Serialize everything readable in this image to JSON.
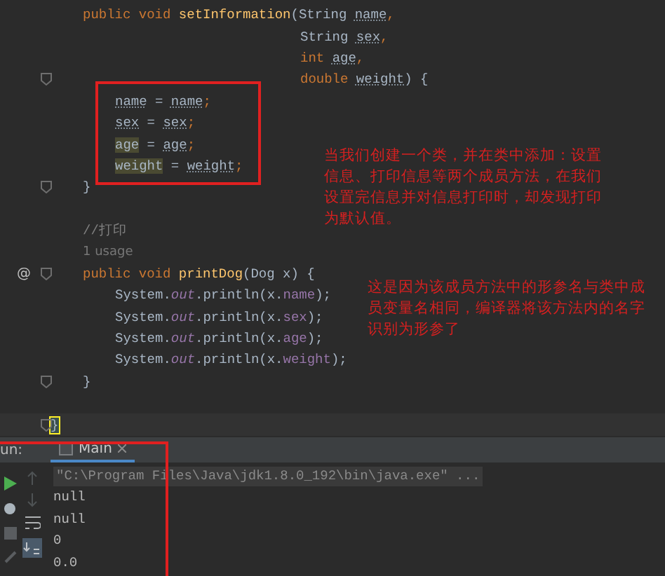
{
  "code_lines": [
    {
      "kind": "member",
      "fold": false,
      "tokens": [
        {
          "text": "public void ",
          "kind": "kw"
        },
        {
          "text": "setInformation",
          "kind": "fn"
        },
        {
          "text": "(String ",
          "kind": "txt"
        },
        {
          "text": "name",
          "kind": "ul"
        },
        {
          "text": ",",
          "kind": "kw"
        }
      ]
    },
    {
      "kind": "param",
      "fold": false,
      "tokens": [
        {
          "text": "String ",
          "kind": "txt"
        },
        {
          "text": "sex",
          "kind": "ul"
        },
        {
          "text": ",",
          "kind": "kw"
        }
      ]
    },
    {
      "kind": "param",
      "fold": false,
      "tokens": [
        {
          "text": "int ",
          "kind": "kw"
        },
        {
          "text": "age",
          "kind": "ul"
        },
        {
          "text": ",",
          "kind": "kw"
        }
      ]
    },
    {
      "kind": "param",
      "fold": true,
      "tokens": [
        {
          "text": "double ",
          "kind": "kw"
        },
        {
          "text": "weight",
          "kind": "ul"
        },
        {
          "text": ") {",
          "kind": "txt"
        }
      ]
    },
    {
      "kind": "body",
      "fold": false,
      "tokens": [
        {
          "text": "name",
          "kind": "ul"
        },
        {
          "text": " = ",
          "kind": "txt"
        },
        {
          "text": "name",
          "kind": "ul"
        },
        {
          "text": ";",
          "kind": "kw"
        }
      ]
    },
    {
      "kind": "body",
      "fold": false,
      "tokens": [
        {
          "text": "sex",
          "kind": "ul"
        },
        {
          "text": " = ",
          "kind": "txt"
        },
        {
          "text": "sex",
          "kind": "ul"
        },
        {
          "text": ";",
          "kind": "kw"
        }
      ]
    },
    {
      "kind": "body",
      "fold": false,
      "tokens": [
        {
          "text": "age",
          "kind": "hl"
        },
        {
          "text": " = ",
          "kind": "txt"
        },
        {
          "text": "age",
          "kind": "ul"
        },
        {
          "text": ";",
          "kind": "kw"
        }
      ]
    },
    {
      "kind": "body",
      "fold": false,
      "tokens": [
        {
          "text": "weight",
          "kind": "hl"
        },
        {
          "text": " = ",
          "kind": "txt"
        },
        {
          "text": "weight",
          "kind": "ul"
        },
        {
          "text": ";",
          "kind": "kw"
        }
      ]
    },
    {
      "kind": "member",
      "fold": true,
      "tokens": [
        {
          "text": "}",
          "kind": "txt"
        }
      ]
    },
    {
      "kind": "blank"
    },
    {
      "kind": "member",
      "fold": false,
      "tokens": [
        {
          "text": "//打印",
          "kind": "comment"
        }
      ]
    },
    {
      "kind": "member",
      "fold": false,
      "tokens": [
        {
          "text": "1 usage",
          "kind": "hint"
        }
      ]
    },
    {
      "kind": "member",
      "fold": true,
      "gutter": "@",
      "tokens": [
        {
          "text": "public void ",
          "kind": "kw"
        },
        {
          "text": "printDog",
          "kind": "fn"
        },
        {
          "text": "(Dog x) {",
          "kind": "txt"
        }
      ]
    },
    {
      "kind": "body",
      "fold": false,
      "tokens": [
        {
          "text": "System.",
          "kind": "txt"
        },
        {
          "text": "out",
          "kind": "static"
        },
        {
          "text": ".println(x.",
          "kind": "txt"
        },
        {
          "text": "name",
          "kind": "field"
        },
        {
          "text": ");",
          "kind": "txt"
        }
      ]
    },
    {
      "kind": "body",
      "fold": false,
      "tokens": [
        {
          "text": "System.",
          "kind": "txt"
        },
        {
          "text": "out",
          "kind": "static"
        },
        {
          "text": ".println(x.",
          "kind": "txt"
        },
        {
          "text": "sex",
          "kind": "field"
        },
        {
          "text": ");",
          "kind": "txt"
        }
      ]
    },
    {
      "kind": "body",
      "fold": false,
      "tokens": [
        {
          "text": "System.",
          "kind": "txt"
        },
        {
          "text": "out",
          "kind": "static"
        },
        {
          "text": ".println(x.",
          "kind": "txt"
        },
        {
          "text": "age",
          "kind": "field"
        },
        {
          "text": ");",
          "kind": "txt"
        }
      ]
    },
    {
      "kind": "body",
      "fold": false,
      "tokens": [
        {
          "text": "System.",
          "kind": "txt"
        },
        {
          "text": "out",
          "kind": "static"
        },
        {
          "text": ".println(x.",
          "kind": "txt"
        },
        {
          "text": "weight",
          "kind": "field"
        },
        {
          "text": ");",
          "kind": "txt"
        }
      ]
    },
    {
      "kind": "member",
      "fold": true,
      "tokens": [
        {
          "text": "}",
          "kind": "txt"
        }
      ]
    },
    {
      "kind": "blank"
    },
    {
      "kind": "top",
      "fold": true,
      "current": true,
      "tokens": [
        {
          "text": "}",
          "kind": "brace"
        }
      ]
    }
  ],
  "annotations": [
    {
      "text": "当我们创建一个类，并在类中添加：设置信息、打印信息等两个成员方法，在我们设置完信息并对信息打印时，却发现打印为默认值。"
    },
    {
      "text": "这是因为该成员方法中的形参名与类中成员变量名相同，编译器将该方法内的名字识别为形参了"
    }
  ],
  "run_panel": {
    "label": "un:",
    "tab": {
      "label": "Main",
      "selected": true
    },
    "command": "\"C:\\Program Files\\Java\\jdk1.8.0_192\\bin\\java.exe\" ...",
    "output": [
      "null",
      "null",
      "0",
      "0.0"
    ]
  }
}
